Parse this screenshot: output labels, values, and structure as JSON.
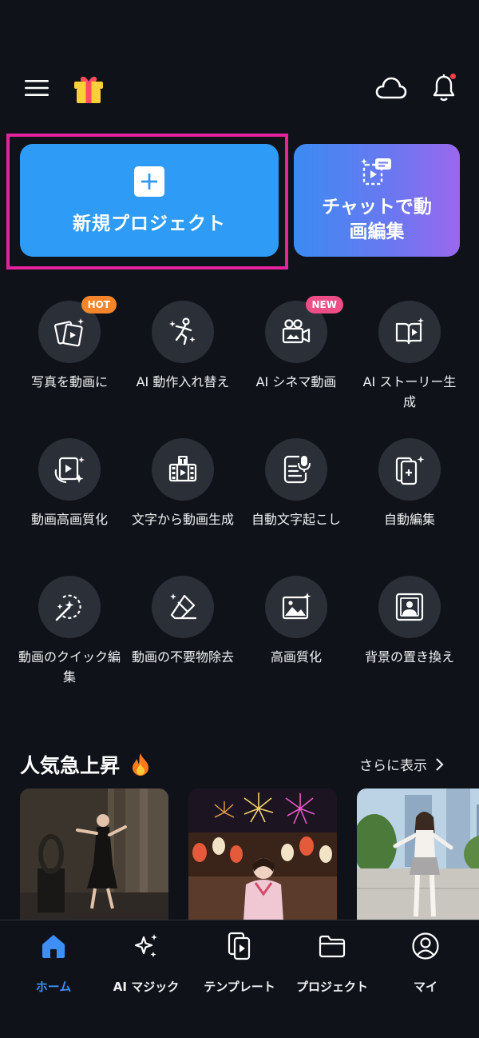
{
  "header": {
    "menu_icon": "hamburger-menu-icon",
    "gift_icon": "gift-icon",
    "cloud_icon": "cloud-icon",
    "bell_icon": "bell-icon"
  },
  "actions": {
    "new_project_label": "新規プロジェクト",
    "chat_edit_label": "チャットで動画編集"
  },
  "tools": [
    {
      "label": "写真を動画に",
      "badge": "HOT",
      "icon": "photo-to-video-icon"
    },
    {
      "label": "AI 動作入れ替え",
      "badge": "",
      "icon": "dancing-figure-icon"
    },
    {
      "label": "AI シネマ動画",
      "badge": "NEW",
      "icon": "cinema-camera-icon"
    },
    {
      "label": "AI ストーリー生成",
      "badge": "",
      "icon": "story-book-icon"
    },
    {
      "label": "動画高画質化",
      "badge": "",
      "icon": "video-enhance-icon"
    },
    {
      "label": "文字から動画生成",
      "badge": "",
      "icon": "text-to-video-icon"
    },
    {
      "label": "自動文字起こし",
      "badge": "",
      "icon": "transcribe-mic-icon"
    },
    {
      "label": "自動編集",
      "badge": "",
      "icon": "auto-edit-icon"
    },
    {
      "label": "動画のクイック編集",
      "badge": "",
      "icon": "magic-wand-icon"
    },
    {
      "label": "動画の不要物除去",
      "badge": "",
      "icon": "eraser-icon"
    },
    {
      "label": "高画質化",
      "badge": "",
      "icon": "image-enhance-icon"
    },
    {
      "label": "背景の置き換え",
      "badge": "",
      "icon": "background-replace-icon"
    }
  ],
  "trending": {
    "title": "人気急上昇",
    "more_label": "さらに表示"
  },
  "tabs": [
    {
      "label": "ホーム",
      "icon": "home-icon",
      "active": true
    },
    {
      "label": "AI マジック",
      "icon": "sparkle-icon",
      "active": false
    },
    {
      "label": "テンプレート",
      "icon": "template-icon",
      "active": false
    },
    {
      "label": "プロジェクト",
      "icon": "folder-icon",
      "active": false
    },
    {
      "label": "マイ",
      "icon": "user-icon",
      "active": false
    }
  ],
  "colors": {
    "accent": "#2e9cf6",
    "highlight": "#e6239f",
    "active_tab": "#3d8ff5"
  }
}
